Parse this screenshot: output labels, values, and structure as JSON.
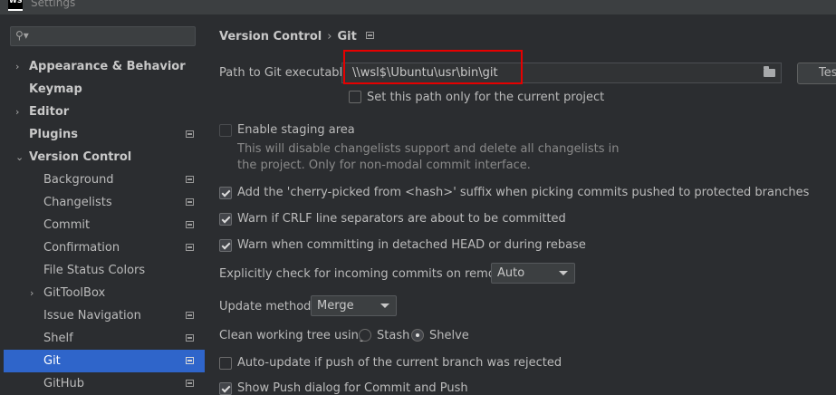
{
  "window": {
    "title": "Settings",
    "logo": "WS"
  },
  "sidebar": {
    "search_placeholder": "",
    "items": [
      {
        "label": "Appearance & Behavior",
        "bold": true,
        "arrow": "›"
      },
      {
        "label": "Keymap",
        "bold": true
      },
      {
        "label": "Editor",
        "bold": true,
        "arrow": "›"
      },
      {
        "label": "Plugins",
        "bold": true
      },
      {
        "label": "Version Control",
        "bold": true,
        "arrow": "⌄"
      },
      {
        "label": "Background"
      },
      {
        "label": "Changelists"
      },
      {
        "label": "Commit"
      },
      {
        "label": "Confirmation"
      },
      {
        "label": "File Status Colors"
      },
      {
        "label": "GitToolBox",
        "arrow": "›"
      },
      {
        "label": "Issue Navigation"
      },
      {
        "label": "Shelf"
      },
      {
        "label": "Git",
        "selected": true
      },
      {
        "label": "GitHub"
      }
    ]
  },
  "breadcrumb": {
    "parent": "Version Control",
    "separator": "›",
    "current": "Git"
  },
  "git_path": {
    "label": "Path to Git executable:",
    "value": "\\\\wsl$\\Ubuntu\\usr\\bin\\git",
    "test_button": "Test",
    "project_only_label": "Set this path only for the current project"
  },
  "staging": {
    "label": "Enable staging area",
    "desc_line1": "This will disable changelists support and delete all changelists in",
    "desc_line2": "the project. Only for non-modal commit interface."
  },
  "options": {
    "cherry_pick": "Add the 'cherry-picked from <hash>' suffix when picking commits pushed to protected branches",
    "crlf": "Warn if CRLF line separators are about to be committed",
    "detached_head": "Warn when committing in detached HEAD or during rebase"
  },
  "incoming": {
    "label": "Explicitly check for incoming commits on remotes:",
    "value": "Auto"
  },
  "update_method": {
    "label": "Update method:",
    "value": "Merge"
  },
  "clean_tree": {
    "label": "Clean working tree using:",
    "opt1": "Stash",
    "opt2": "Shelve",
    "selected": "Shelve"
  },
  "auto_update": {
    "label": "Auto-update if push of the current branch was rejected"
  },
  "show_push": {
    "label": "Show Push dialog for Commit and Push"
  }
}
